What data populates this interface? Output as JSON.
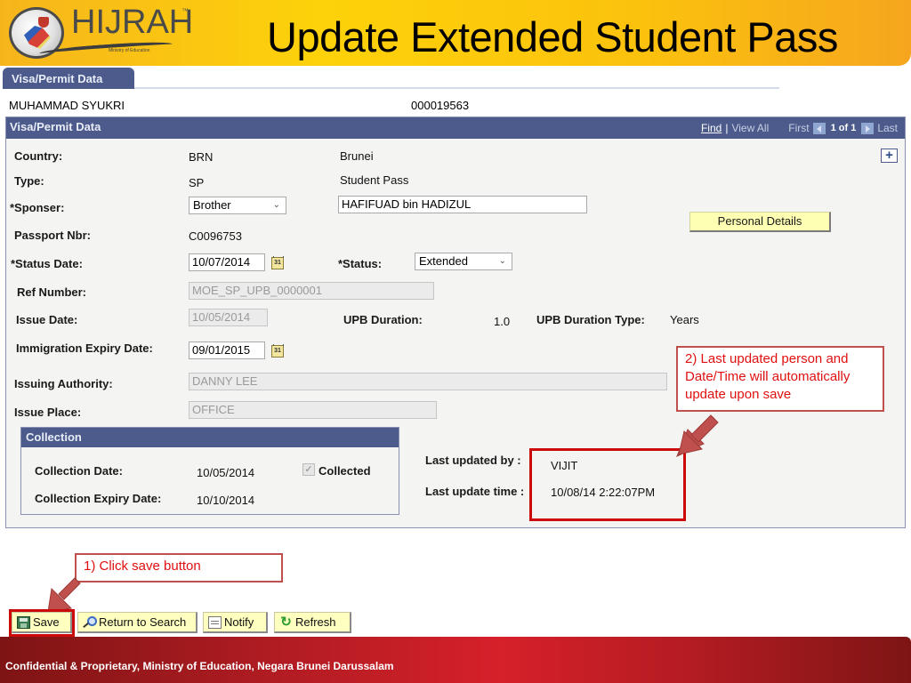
{
  "header": {
    "logo_text": "HIJRAH",
    "logo_trademark": "™",
    "logo_tagline": "Ministry of Education",
    "page_title": "Update Extended Student Pass"
  },
  "tab": {
    "label": "Visa/Permit Data"
  },
  "student": {
    "name": "MUHAMMAD SYUKRI",
    "id": "000019563"
  },
  "panel": {
    "title": "Visa/Permit Data",
    "nav": {
      "find": "Find",
      "separator": "|",
      "view_all": "View All",
      "first": "First",
      "count": "1 of 1",
      "last": "Last"
    },
    "add_button": "+"
  },
  "form": {
    "country": {
      "label": "Country:",
      "code": "BRN",
      "name": "Brunei"
    },
    "type": {
      "label": "Type:",
      "code": "SP",
      "name": "Student Pass"
    },
    "sponsor": {
      "label": "*Sponser:",
      "selected": "Brother",
      "name_value": "HAFIFUAD bin HADIZUL"
    },
    "passport": {
      "label": "Passport Nbr:",
      "value": "C0096753"
    },
    "status_date": {
      "label": "*Status Date:",
      "value": "10/07/2014"
    },
    "status": {
      "label": "*Status:",
      "selected": "Extended"
    },
    "ref_number": {
      "label": "Ref Number:",
      "value": "MOE_SP_UPB_0000001"
    },
    "issue_date": {
      "label": "Issue Date:",
      "value": "10/05/2014"
    },
    "upb_duration": {
      "label": "UPB Duration:",
      "value": "1.0"
    },
    "upb_duration_type": {
      "label": "UPB Duration Type:",
      "value": "Years"
    },
    "immigration_expiry": {
      "label": "Immigration Expiry Date:",
      "value": "09/01/2015"
    },
    "issuing_authority": {
      "label": "Issuing Authority:",
      "value": "DANNY LEE"
    },
    "issue_place": {
      "label": "Issue Place:",
      "value": "OFFICE"
    },
    "calendar_icon_text": "31"
  },
  "personal_details_button": "Personal Details",
  "collection": {
    "title": "Collection",
    "collection_date": {
      "label": "Collection Date:",
      "value": "10/05/2014"
    },
    "collection_expiry": {
      "label": "Collection Expiry Date:",
      "value": "10/10/2014"
    },
    "collected": {
      "label": "Collected",
      "checked": true,
      "check_glyph": "✓"
    }
  },
  "last_updated": {
    "by_label": "Last updated by :",
    "by_value": "VIJIT",
    "time_label": "Last update time :",
    "time_value": "10/08/14  2:22:07PM"
  },
  "annotations": {
    "step1": "1) Click save button",
    "step2": "2) Last updated person and Date/Time will automatically update upon save",
    "accent_color": "#c0504d",
    "highlight_color": "#cc0a0a"
  },
  "toolbar": {
    "save": "Save",
    "return_to_search": "Return to Search",
    "notify": "Notify",
    "refresh": "Refresh"
  },
  "footer": {
    "text": "Confidential & Proprietary, Ministry of Education, Negara Brunei Darussalam"
  },
  "colors": {
    "header_blue": "#4c5b8c",
    "banner_yellow": "#fdd20a",
    "footer_red": "#b01c22",
    "button_yellow": "#ffffc0"
  }
}
